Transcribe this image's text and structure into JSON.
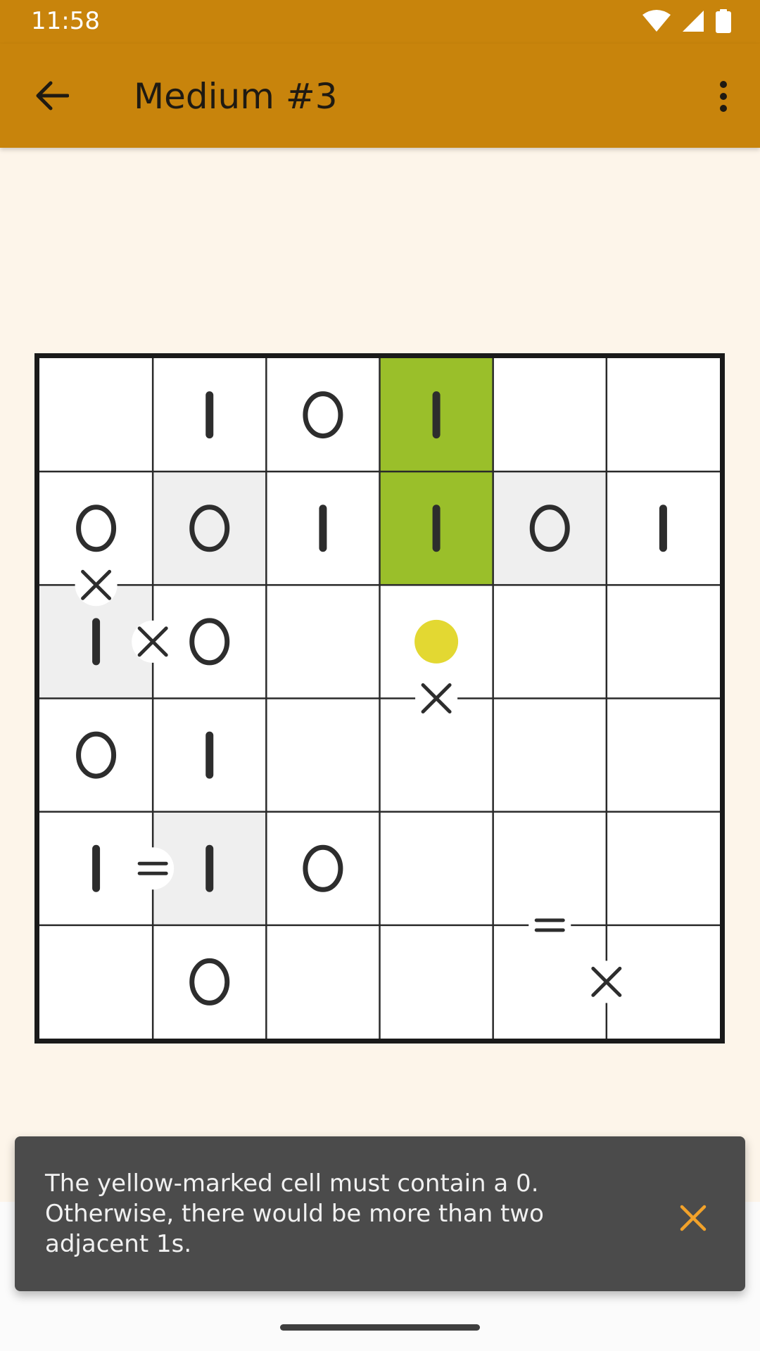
{
  "status_bar": {
    "time": "11:58",
    "icons": [
      "wifi-icon",
      "cell-signal-icon",
      "battery-icon"
    ]
  },
  "app_bar": {
    "title": "Medium #3",
    "back_icon": "arrow-back-icon",
    "menu_icon": "more-vert-icon"
  },
  "board": {
    "size": 6,
    "cells": [
      [
        "",
        "1",
        "0",
        "1",
        "",
        ""
      ],
      [
        "0",
        "0",
        "1",
        "1",
        "0",
        "1"
      ],
      [
        "1",
        "0",
        "",
        "",
        "",
        ""
      ],
      [
        "0",
        "1",
        "",
        "",
        "",
        ""
      ],
      [
        "1",
        "1",
        "0",
        "",
        "",
        ""
      ],
      [
        "",
        "0",
        "",
        "",
        "",
        ""
      ]
    ],
    "cell_highlights": [
      [
        "none",
        "none",
        "none",
        "green",
        "none",
        "none"
      ],
      [
        "none",
        "gray",
        "none",
        "green",
        "gray",
        "none"
      ],
      [
        "gray",
        "none",
        "none",
        "none",
        "none",
        "none"
      ],
      [
        "none",
        "none",
        "none",
        "none",
        "none",
        "none"
      ],
      [
        "none",
        "gray",
        "none",
        "none",
        "none",
        "none"
      ],
      [
        "none",
        "none",
        "none",
        "none",
        "none",
        "none"
      ]
    ],
    "hint_markers": [
      {
        "row": 2,
        "col": 3,
        "type": "yellow-dot"
      }
    ],
    "constraints": [
      {
        "between": [
          [
            1,
            0
          ],
          [
            2,
            0
          ]
        ],
        "symbol": "×",
        "badge": true
      },
      {
        "between": [
          [
            2,
            0
          ],
          [
            2,
            1
          ]
        ],
        "symbol": "×",
        "badge": true
      },
      {
        "between": [
          [
            2,
            3
          ],
          [
            3,
            3
          ]
        ],
        "symbol": "×",
        "badge": false
      },
      {
        "between": [
          [
            4,
            0
          ],
          [
            4,
            1
          ]
        ],
        "symbol": "=",
        "badge": true
      },
      {
        "between": [
          [
            4,
            4
          ],
          [
            5,
            4
          ]
        ],
        "symbol": "=",
        "badge": false
      },
      {
        "between": [
          [
            5,
            4
          ],
          [
            5,
            5
          ]
        ],
        "symbol": "×",
        "badge": false
      }
    ],
    "colors": {
      "green": "#9abf2a",
      "gray": "#efefef",
      "yellow": "#e3d832",
      "grid_line": "#2a2a2a",
      "glyph": "#2d2d2d"
    }
  },
  "snackbar": {
    "message": "The yellow-marked cell must contain a 0. Otherwise, there would be more than two adjacent 1s.",
    "close_icon": "close-icon",
    "accent_color": "#f2a22a"
  },
  "theme": {
    "primary": "#c8840c",
    "background": "#fdf5ea"
  }
}
